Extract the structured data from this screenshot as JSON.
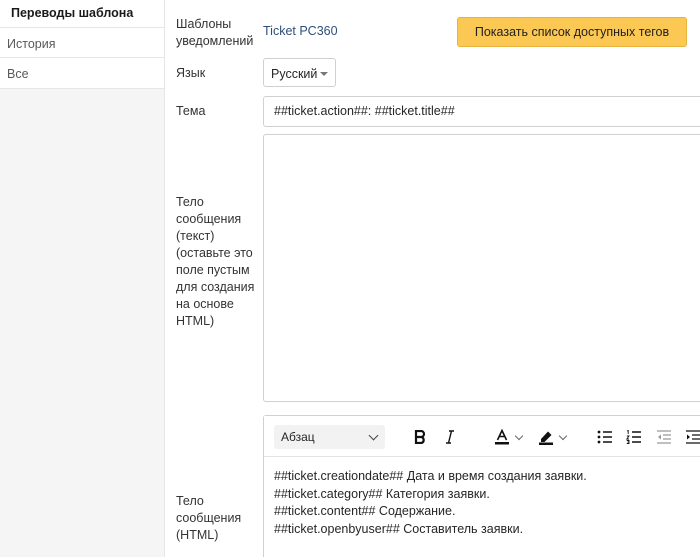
{
  "sidebar": {
    "title": "Переводы шаблона",
    "items": [
      {
        "label": "История"
      },
      {
        "label": "Все"
      }
    ]
  },
  "form": {
    "templates_label": "Шаблоны уведомлений",
    "templates_value": "Ticket PC360",
    "show_tags_button": "Показать список доступных тегов",
    "language_label": "Язык",
    "language_value": "Русский",
    "subject_label": "Тема",
    "subject_value": "##ticket.action##: ##ticket.title##",
    "body_text_label": "Тело сообщения (текст) (оставьте это поле пустым для создания на основе HTML)",
    "body_html_label": "Тело сообщения (HTML)"
  },
  "editor": {
    "block_format": "Абзац",
    "lines": [
      "##ticket.creationdate## Дата и время создания заявки.",
      "##ticket.category## Категория заявки.",
      "##ticket.content## Содержание.",
      "##ticket.openbyuser## Составитель заявки."
    ]
  },
  "colors": {
    "accent_button": "#fbc853",
    "link": "#2f4f7a",
    "sidebar_bg": "#f5f5f5"
  }
}
